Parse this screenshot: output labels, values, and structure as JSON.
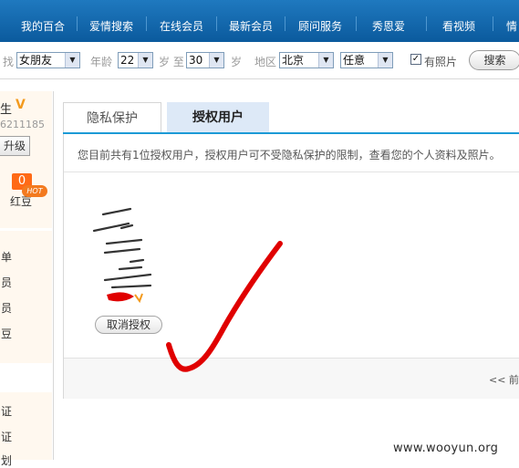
{
  "nav": {
    "items": [
      "我的百合",
      "爱情搜索",
      "在线会员",
      "最新会员",
      "顾问服务",
      "秀恩爱",
      "看视频",
      "情"
    ]
  },
  "search": {
    "find_label": "找",
    "gender_value": "女朋友",
    "age_label": "年龄",
    "age_from": "22",
    "age_to_label": "岁 至",
    "age_to": "30",
    "age_unit": "岁",
    "region_label": "地区",
    "region_value": "北京",
    "region_sub_value": "任意",
    "photo_checked": true,
    "photo_label": "有照片",
    "search_button": "搜索"
  },
  "sidebar": {
    "name_fragment": "生",
    "vip_mark": "V",
    "user_id_fragment": "6211185",
    "upgrade_button": "升级",
    "hongdou_count": "0",
    "hongdou_label": "红豆",
    "menu": [
      "单",
      "员",
      "员",
      "豆"
    ],
    "hot_badge": "HOT",
    "bottom_items": [
      "证",
      "证",
      "划"
    ]
  },
  "tabs": {
    "privacy": "隐私保护",
    "authorized": "授权用户"
  },
  "main": {
    "notice": "您目前共有1位授权用户，授权用户可不受隐私保护的限制，查看您的个人资料及照片。",
    "cancel_button": "取消授权",
    "pager": "<<  前"
  },
  "watermark": "www.wooyun.org",
  "colors": {
    "nav_bg": "#1467ad",
    "tab_active_bg": "#dde9f7",
    "tab_underline": "#1c9ad6",
    "accent_orange": "#ff6a16",
    "scribble_red": "#e00000"
  },
  "icons": {
    "select_arrow": "chevron-down-icon",
    "photo_check": "checkmark-icon",
    "vip": "vip-v-icon",
    "annotation": "red-checkmark-scribble"
  }
}
